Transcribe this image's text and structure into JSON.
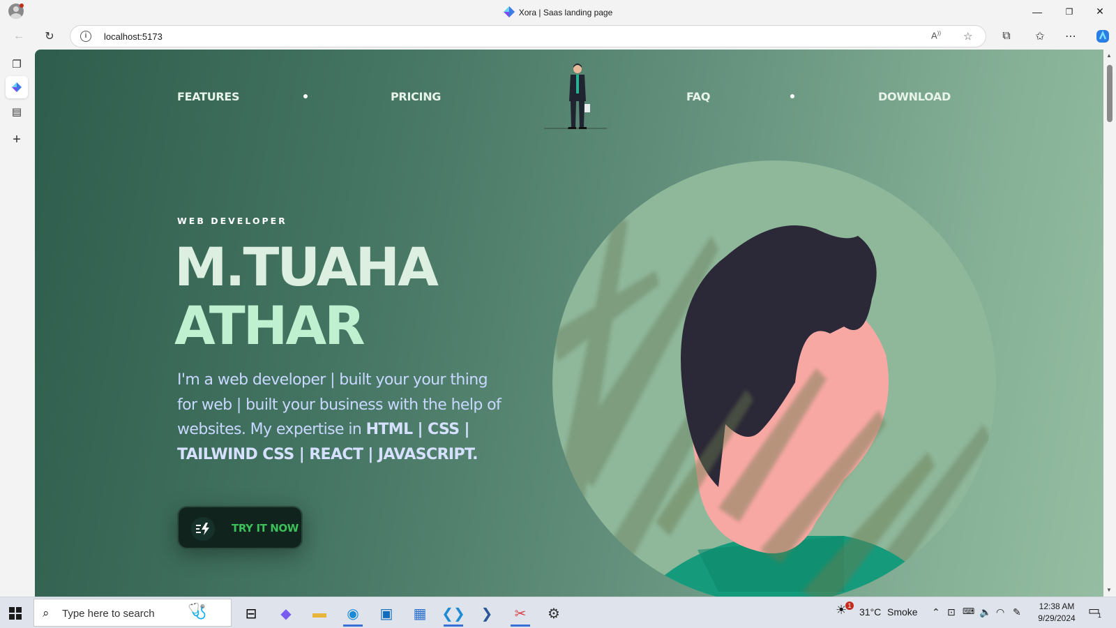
{
  "window": {
    "title": "Xora | Saas landing page",
    "controls": {
      "minimize": "—",
      "restore": "❐",
      "close": "✕"
    }
  },
  "address_bar": {
    "url": "localhost:5173"
  },
  "page": {
    "nav": {
      "left": [
        "FEATURES",
        "PRICING"
      ],
      "right": [
        "FAQ",
        "DOWNLOAD"
      ]
    },
    "hero": {
      "eyebrow": "WEB DEVELOPER",
      "name_line1": "M.TUAHA",
      "name_line2": "ATHAR",
      "description_plain": "I'm a web developer | built your your thing for web | built your business with the help of websites. My expertise in ",
      "description_bold": "HTML | CSS | TAILWIND CSS | REACT | JAVASCRIPT.",
      "cta_label": "TRY IT NOW"
    },
    "colors": {
      "bg_start": "#2f5d4d",
      "bg_end": "#95bda2",
      "name_line1": "#dcefe0",
      "name_line2": "#bff0cf",
      "description": "#c9d8ff",
      "cta_text": "#3dbf5a"
    }
  },
  "taskbar": {
    "search_placeholder": "Type here to search",
    "weather_temp": "31°C",
    "weather_text": "Smoke",
    "time": "12:38 AM",
    "date": "9/29/2024",
    "notification_count": "1",
    "weather_badge": "1"
  }
}
